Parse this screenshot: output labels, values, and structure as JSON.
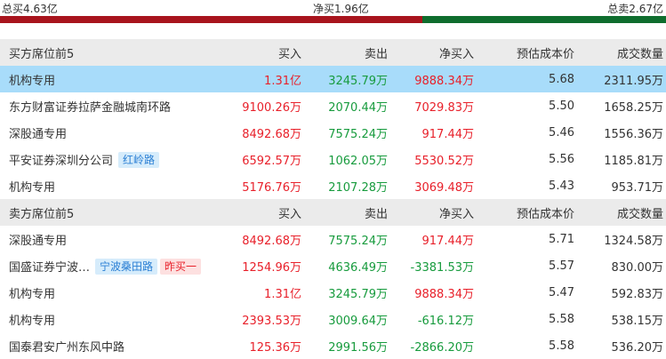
{
  "summary": {
    "total_buy": "总买4.63亿",
    "net_buy": "净买1.96亿",
    "total_sell": "总卖2.67亿",
    "buy_share": 0.634,
    "colors": {
      "buy": "#a8141d",
      "sell": "#0f6d2e",
      "red_text": "#e8202a",
      "green_text": "#179b3d",
      "highlight": "#a8dcfa"
    }
  },
  "headers": [
    "买入",
    "卖出",
    "净买入",
    "预估成本价",
    "成交数量"
  ],
  "buy_section": {
    "title": "买方席位前5",
    "rows": [
      {
        "name": "机构专用",
        "tags": [],
        "buy": "1.31亿",
        "sell": "3245.79万",
        "net": "9888.34万",
        "cost": "5.68",
        "volume": "2311.95万",
        "highlight": true
      },
      {
        "name": "东方财富证券拉萨金融城南环路",
        "tags": [],
        "buy": "9100.26万",
        "sell": "2070.44万",
        "net": "7029.83万",
        "cost": "5.50",
        "volume": "1658.25万"
      },
      {
        "name": "深股通专用",
        "tags": [],
        "buy": "8492.68万",
        "sell": "7575.24万",
        "net": "917.44万",
        "cost": "5.46",
        "volume": "1556.36万"
      },
      {
        "name": "平安证券深圳分公司",
        "tags": [
          {
            "text": "红岭路",
            "style": "blue"
          }
        ],
        "buy": "6592.57万",
        "sell": "1062.05万",
        "net": "5530.52万",
        "cost": "5.56",
        "volume": "1185.81万"
      },
      {
        "name": "机构专用",
        "tags": [],
        "buy": "5176.76万",
        "sell": "2107.28万",
        "net": "3069.48万",
        "cost": "5.43",
        "volume": "953.71万"
      }
    ]
  },
  "sell_section": {
    "title": "卖方席位前5",
    "rows": [
      {
        "name": "深股通专用",
        "tags": [],
        "buy": "8492.68万",
        "sell": "7575.24万",
        "net": "917.44万",
        "cost": "5.71",
        "volume": "1324.58万"
      },
      {
        "name": "国盛证券宁波…",
        "tags": [
          {
            "text": "宁波桑田路",
            "style": "blue"
          },
          {
            "text": "昨买一",
            "style": "red"
          }
        ],
        "buy": "1254.96万",
        "sell": "4636.49万",
        "net": "-3381.53万",
        "cost": "5.57",
        "volume": "830.00万"
      },
      {
        "name": "机构专用",
        "tags": [],
        "buy": "1.31亿",
        "sell": "3245.79万",
        "net": "9888.34万",
        "cost": "5.47",
        "volume": "592.83万"
      },
      {
        "name": "机构专用",
        "tags": [],
        "buy": "2393.53万",
        "sell": "3009.64万",
        "net": "-616.12万",
        "cost": "5.58",
        "volume": "538.15万"
      },
      {
        "name": "国泰君安广州东风中路",
        "tags": [],
        "buy": "125.36万",
        "sell": "2991.56万",
        "net": "-2866.20万",
        "cost": "5.58",
        "volume": "536.20万"
      }
    ]
  }
}
